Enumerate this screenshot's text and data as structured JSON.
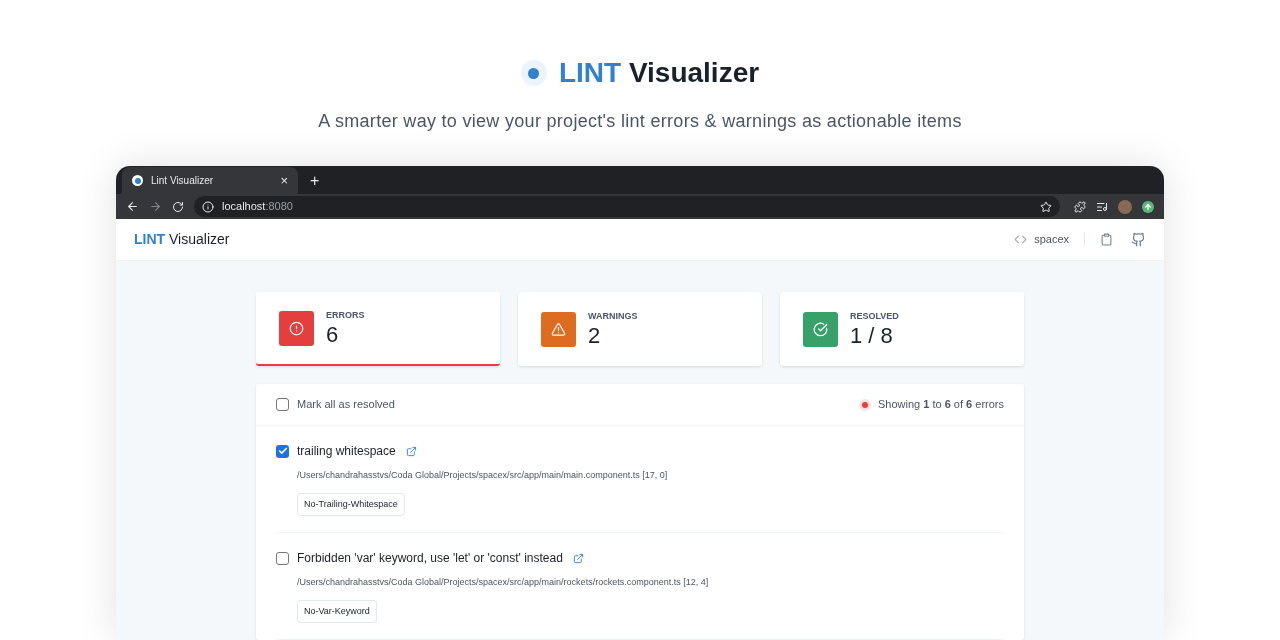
{
  "hero": {
    "brand": "LINT",
    "title": "Visualizer",
    "subtitle": "A smarter way to view your project's lint errors & warnings as actionable items"
  },
  "browser": {
    "tab_title": "Lint Visualizer",
    "tab_close": "×",
    "new_tab": "+",
    "url_host": "localhost",
    "url_port": ":8080"
  },
  "app_header": {
    "brand": "LINT",
    "title": "Visualizer",
    "project": "spacex"
  },
  "stats": [
    {
      "kind": "error",
      "label": "ERRORS",
      "value": "6",
      "selected": true
    },
    {
      "kind": "warning",
      "label": "WARNINGS",
      "value": "2",
      "selected": false
    },
    {
      "kind": "resolved",
      "label": "RESOLVED",
      "value": "1 / 8",
      "selected": false
    }
  ],
  "list": {
    "mark_all": {
      "label": "Mark all as resolved",
      "checked": false
    },
    "summary": "Showing **1** to **6** of **6** errors",
    "items": [
      {
        "message": "trailing whitespace",
        "path": "/Users/chandrahasstvs/Coda Global/Projects/spacex/src/app/main/main.component.ts [17, 0]",
        "rule": "No-Trailing-Whitespace",
        "checked": true
      },
      {
        "message": "Forbidden 'var' keyword, use 'let' or 'const' instead",
        "path": "/Users/chandrahasstvs/Coda Global/Projects/spacex/src/app/main/rockets/rockets.component.ts [12, 4]",
        "rule": "No-Var-Keyword",
        "checked": false
      }
    ]
  }
}
